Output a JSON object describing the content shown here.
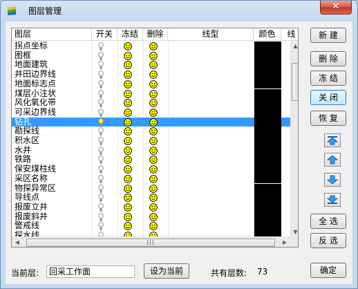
{
  "window": {
    "title": "图层管理",
    "close_label": "✕"
  },
  "columns": [
    "图层",
    "开关",
    "冻结",
    "删除",
    "线型",
    "颜色",
    "线"
  ],
  "layers": [
    "拐点坐标",
    "图框",
    "地面建筑",
    "井田边界线",
    "地面标志点",
    "煤层小注状",
    "风化氧化带",
    "可采边界线",
    "钻孔",
    "勘探线",
    "积水区",
    "水井",
    "铁路",
    "保安煤柱线",
    "采区名称",
    "物探异常区",
    "导线点",
    "报废立井",
    "报废斜井",
    "警戒线",
    "探水线"
  ],
  "selected_layer": "钻孔",
  "buttons": {
    "new": "新 建",
    "delete": "删 除",
    "freeze": "冻 结",
    "close": "关 闭",
    "restore": "恢 复",
    "select_all": "全 选",
    "invert": "反 选",
    "set_current": "设为当前",
    "ok": "确定"
  },
  "arrow_buttons": [
    "move-top",
    "move-up",
    "move-down",
    "move-bottom"
  ],
  "footer": {
    "current_layer_label": "当前层:",
    "current_layer_value": "回采工作面",
    "total_label": "共有层数:",
    "total_value": "73"
  },
  "colors": {
    "layer_color": "#000000",
    "selection": "#3399ff",
    "face": "#ffff00"
  },
  "icons": {
    "switch": "lightbulb-icon",
    "freeze": "smiley-icon",
    "delete": "smiley-icon"
  }
}
